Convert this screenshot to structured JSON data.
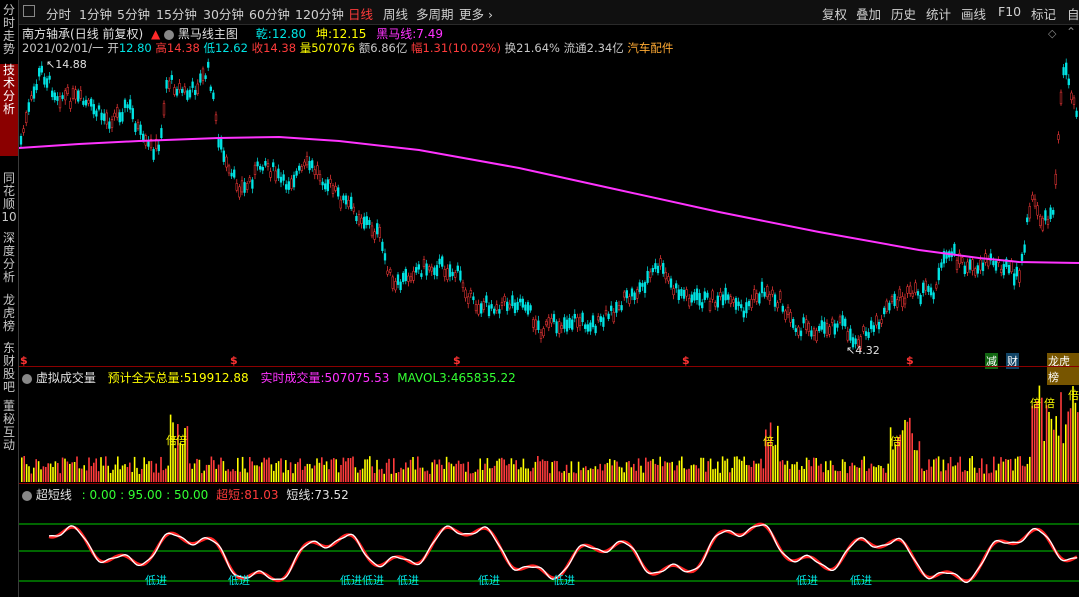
{
  "sidebar": {
    "items": [
      {
        "label": "分时走势",
        "active": false
      },
      {
        "label": "技术分析",
        "active": true
      },
      {
        "label": "同花顺10",
        "active": false
      },
      {
        "label": "深度分析",
        "active": false
      },
      {
        "label": "龙虎榜",
        "active": false
      },
      {
        "label": "东财股吧",
        "active": false
      },
      {
        "label": "董秘互动",
        "active": false
      }
    ]
  },
  "toolbar": {
    "periods": [
      "分时",
      "1分钟",
      "5分钟",
      "15分钟",
      "30分钟",
      "60分钟",
      "120分钟",
      "日线",
      "周线",
      "多周期",
      "更多"
    ],
    "active_period": "日线",
    "right_tools": [
      "复权",
      "叠加",
      "历史",
      "统计",
      "画线",
      "F10",
      "标记",
      "自"
    ]
  },
  "header": {
    "stock_name": "南方轴承",
    "mode": "(日线 前复权)",
    "indicator_name": "黑马线主图",
    "qian_label": "乾:",
    "qian_value": "12.80",
    "kun_label": "坤:",
    "kun_value": "12.15",
    "heima_label": "黑马线:",
    "heima_value": "7.49"
  },
  "quote": {
    "date": "2021/02/01/一",
    "open_label": "开",
    "open": "12.80",
    "high_label": "高",
    "high": "14.38",
    "low_label": "低",
    "low": "12.62",
    "close_label": "收",
    "close": "14.38",
    "vol_label": "量",
    "vol": "507076",
    "amount_label": "额",
    "amount": "6.86亿",
    "change_label": "幅",
    "change": "1.31(10.02%)",
    "turnover_label": "换",
    "turnover": "21.64%",
    "float_label": "流通",
    "float": "2.34亿",
    "sector": "汽车配件"
  },
  "price_labels": {
    "max": "14.88",
    "min": "4.32"
  },
  "main_markers": {
    "dollar": "$",
    "jian": "减",
    "cai": "财",
    "bang": "龙虎榜"
  },
  "volume_panel": {
    "title": "虚拟成交量",
    "forecast_label": "预计全天总量:",
    "forecast_value": "519912.88",
    "realtime_label": "实时成交量:",
    "realtime_value": "507075.53",
    "mavol_label": "MAVOL3:",
    "mavol_value": "465835.22",
    "bei": "倍"
  },
  "short_panel": {
    "title": "超短线",
    "levels": ": 0.00 : 95.00 : 50.00",
    "chao_label": "超短:",
    "chao_value": "81.03",
    "duan_label": "短线:",
    "duan_value": "73.52",
    "low_entry": "低进"
  },
  "colors": {
    "up": "#ff3b3b",
    "down": "#00e5e5",
    "ma_line": "#ff33ff",
    "vol_up": "#ff3b3b",
    "vol_yellow": "#ffff00",
    "short_line": "#ffffff",
    "green_line": "#00cc00"
  }
}
